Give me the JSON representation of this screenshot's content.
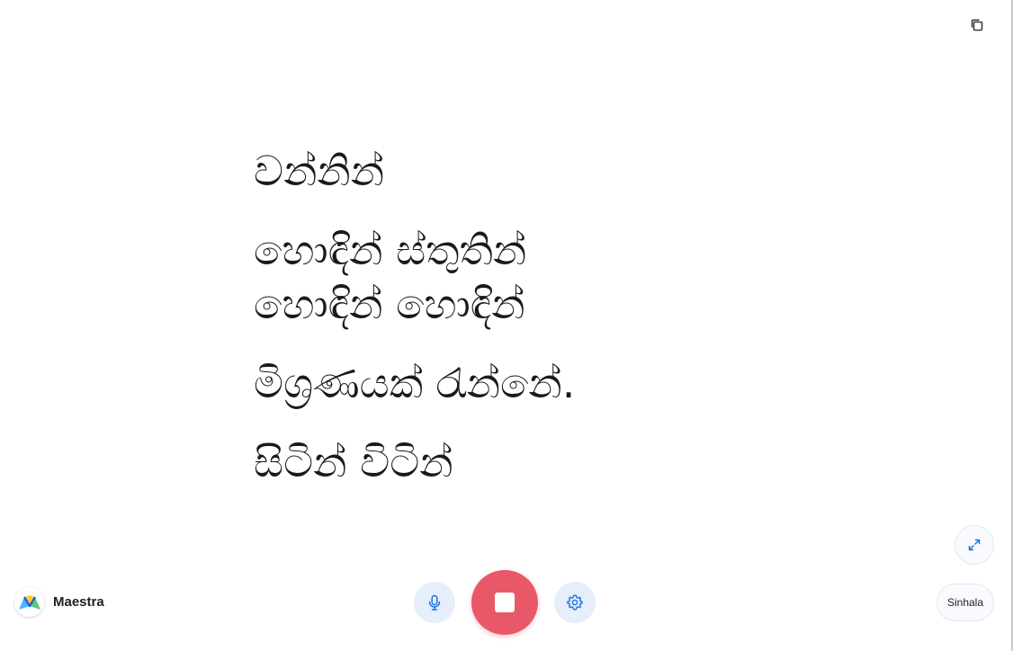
{
  "app": {
    "brand_name": "Maestra",
    "language_label": "Sinhala"
  },
  "transcript": {
    "lines": [
      "වන්නින්",
      "හොඳින් ස්තුතින්",
      "හොඳින් හොඳින්",
      "මිශ්‍රණයක් රැන්නේ.",
      "සිටින් විටින්"
    ]
  },
  "icons": {
    "copy": "copy-icon",
    "expand": "expand-icon",
    "microphone": "microphone-icon",
    "stop": "stop-icon",
    "settings": "gear-icon",
    "logo": "maestra-logo-icon"
  },
  "colors": {
    "stop_button": "#e95868",
    "control_bg": "#e6eefb",
    "accent_blue": "#1a73e8",
    "text": "#1a1a1a"
  }
}
